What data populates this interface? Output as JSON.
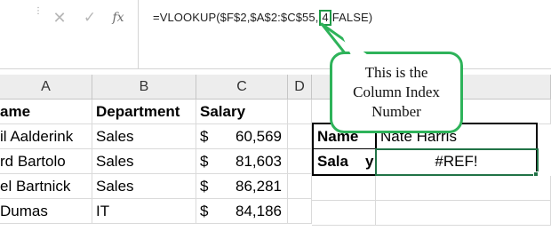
{
  "formula_bar": {
    "cancel_icon": "✕",
    "enter_icon": "✓",
    "fx_label": "fx",
    "formula_before": "=VLOOKUP($F$2,$A$2:$C$55,",
    "formula_highlight": "4",
    "formula_after": "FALSE)"
  },
  "columns": [
    "A",
    "B",
    "C",
    "D"
  ],
  "headers": {
    "name": "ame",
    "department": "Department",
    "salary": "Salary"
  },
  "rows": [
    {
      "name": "il Aalderink",
      "department": "Sales",
      "currency": "$",
      "salary": "60,569"
    },
    {
      "name": "rd Bartolo",
      "department": "Sales",
      "currency": "$",
      "salary": "81,603"
    },
    {
      "name": "el Bartnick",
      "department": "Sales",
      "currency": "$",
      "salary": "86,281"
    },
    {
      "name": "Dumas",
      "department": "IT",
      "currency": "$",
      "salary": "84,186"
    }
  ],
  "lookup": {
    "name_label": "Name",
    "name_value": "Nate Harris",
    "salary_label": "Sala",
    "salary_label_tail": "y",
    "salary_value": "#REF!"
  },
  "callout": {
    "line1": "This is the",
    "line2": "Column Index",
    "line3": "Number"
  },
  "colors": {
    "accent_green": "#2eb35a",
    "selection_green": "#217346"
  }
}
